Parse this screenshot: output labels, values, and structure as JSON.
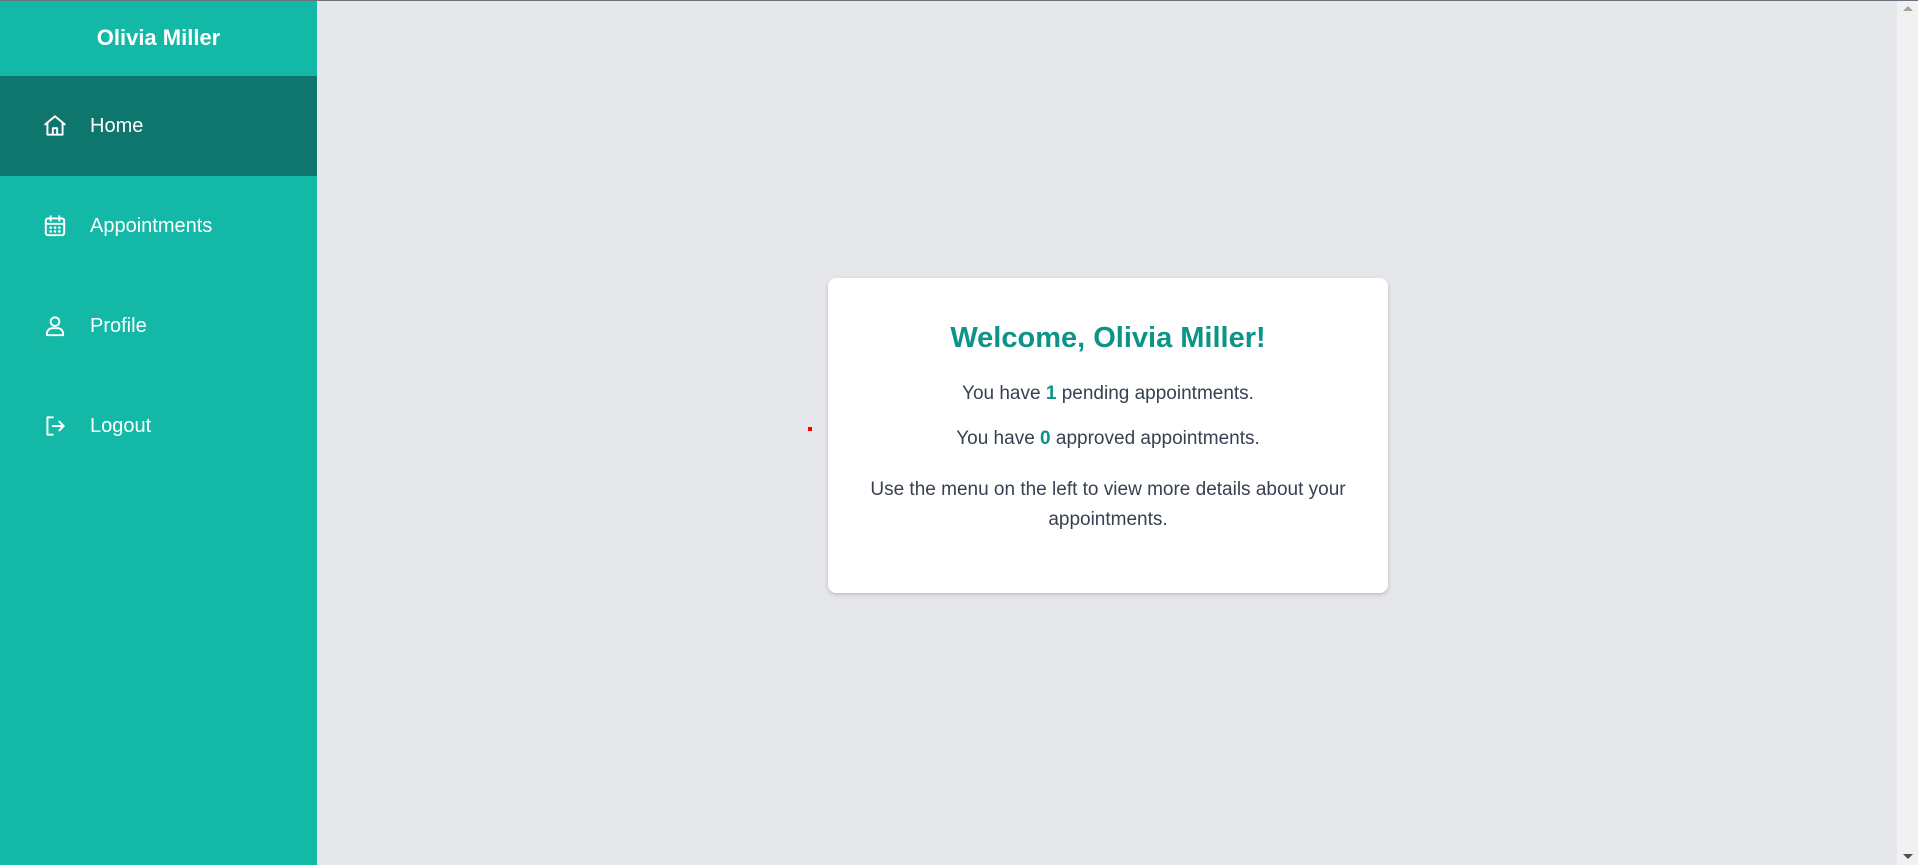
{
  "sidebar": {
    "title": "Olivia Miller",
    "items": [
      {
        "label": "Home",
        "icon": "home-icon",
        "active": true
      },
      {
        "label": "Appointments",
        "icon": "calendar-icon",
        "active": false
      },
      {
        "label": "Profile",
        "icon": "user-icon",
        "active": false
      },
      {
        "label": "Logout",
        "icon": "logout-icon",
        "active": false
      }
    ]
  },
  "card": {
    "title": "Welcome, Olivia Miller!",
    "pending_prefix": "You have",
    "pending_count": "1",
    "pending_suffix": "pending appointments.",
    "approved_prefix": "You have",
    "approved_count": "0",
    "approved_suffix": "approved appointments.",
    "note": "Use the menu on the left to view more details about your appointments."
  },
  "colors": {
    "sidebar": "#14b8a6",
    "sidebar_active": "#0f766e",
    "accent": "#0d9488",
    "background": "#e5e7eb"
  }
}
